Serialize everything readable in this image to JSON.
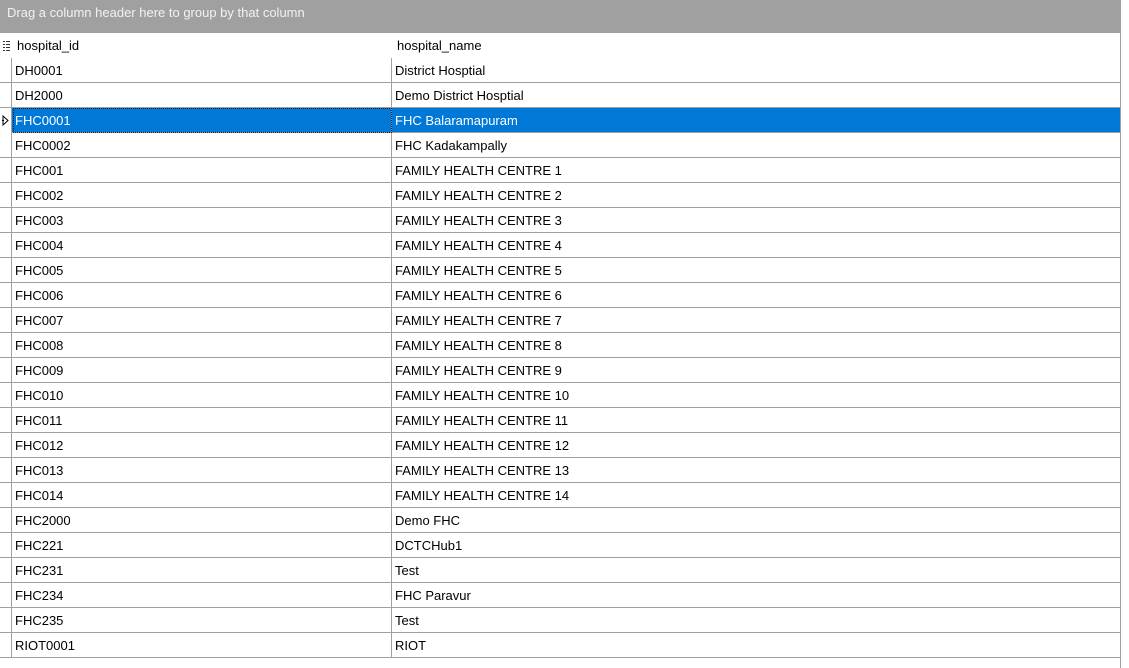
{
  "group_panel": {
    "text": "Drag a column header here to group by that column"
  },
  "columns": {
    "col1": "hospital_id",
    "col2": "hospital_name"
  },
  "colors": {
    "selection": "#0078d7",
    "group_panel_bg": "#a0a0a0",
    "grid_line": "#a0a0a0"
  },
  "icons": {
    "header_indicator": "menu-lines-icon",
    "row_indicator": "current-row-arrow-icon"
  },
  "selected_row_index": 2,
  "rows": [
    {
      "id": "DH0001",
      "name": "District Hosptial"
    },
    {
      "id": "DH2000",
      "name": "Demo District Hosptial"
    },
    {
      "id": "FHC0001",
      "name": "FHC Balaramapuram"
    },
    {
      "id": "FHC0002",
      "name": "FHC Kadakampally"
    },
    {
      "id": "FHC001",
      "name": "FAMILY HEALTH CENTRE 1"
    },
    {
      "id": "FHC002",
      "name": "FAMILY HEALTH CENTRE 2"
    },
    {
      "id": "FHC003",
      "name": "FAMILY HEALTH CENTRE 3"
    },
    {
      "id": "FHC004",
      "name": "FAMILY HEALTH CENTRE 4"
    },
    {
      "id": "FHC005",
      "name": "FAMILY HEALTH CENTRE 5"
    },
    {
      "id": "FHC006",
      "name": "FAMILY HEALTH CENTRE 6"
    },
    {
      "id": "FHC007",
      "name": "FAMILY HEALTH CENTRE 7"
    },
    {
      "id": "FHC008",
      "name": "FAMILY HEALTH CENTRE 8"
    },
    {
      "id": "FHC009",
      "name": "FAMILY HEALTH CENTRE 9"
    },
    {
      "id": "FHC010",
      "name": "FAMILY HEALTH CENTRE 10"
    },
    {
      "id": "FHC011",
      "name": "FAMILY HEALTH CENTRE 11"
    },
    {
      "id": "FHC012",
      "name": "FAMILY HEALTH CENTRE 12"
    },
    {
      "id": "FHC013",
      "name": "FAMILY HEALTH CENTRE 13"
    },
    {
      "id": "FHC014",
      "name": "FAMILY HEALTH CENTRE 14"
    },
    {
      "id": "FHC2000",
      "name": "Demo FHC"
    },
    {
      "id": "FHC221",
      "name": "DCTCHub1"
    },
    {
      "id": "FHC231",
      "name": "Test"
    },
    {
      "id": "FHC234",
      "name": "FHC Paravur"
    },
    {
      "id": "FHC235",
      "name": "Test"
    },
    {
      "id": "RIOT0001",
      "name": "RIOT"
    }
  ]
}
